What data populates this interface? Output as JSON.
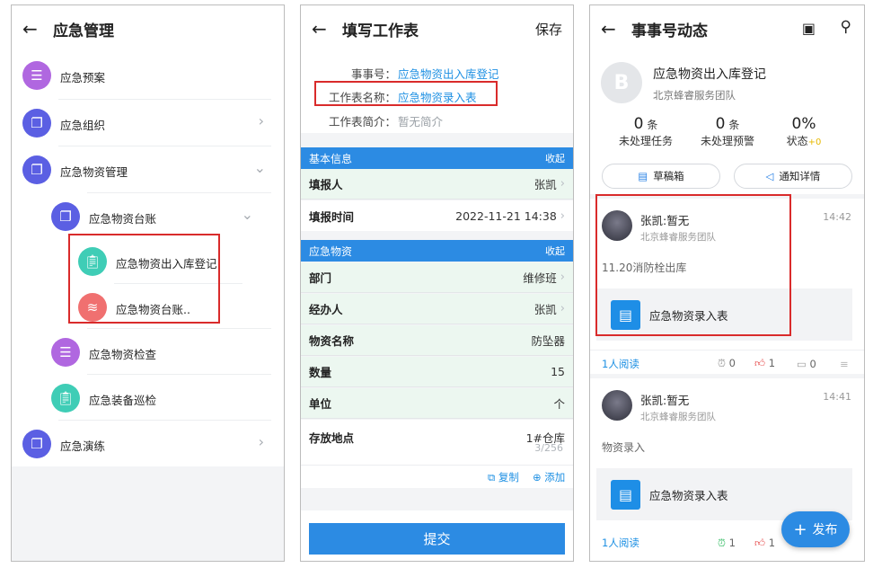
{
  "p1": {
    "title": "应急管理",
    "items": [
      {
        "label": "应急预案",
        "color": "#b067e0",
        "icon": "list-icon"
      },
      {
        "label": "应急组织",
        "color": "#5b5fe3",
        "icon": "layers-icon"
      },
      {
        "label": "应急物资管理",
        "color": "#5b5fe3",
        "icon": "layers-icon"
      },
      {
        "label": "应急物资台账",
        "color": "#5b5fe3",
        "icon": "layers-icon"
      },
      {
        "label": "应急物资出入库登记",
        "color": "#3fcdb6",
        "icon": "clipboard-icon"
      },
      {
        "label": "应急物资台账..",
        "color": "#f07070",
        "icon": "database-icon"
      },
      {
        "label": "应急物资检查",
        "color": "#b067e0",
        "icon": "list-icon"
      },
      {
        "label": "应急装备巡检",
        "color": "#3fcdb6",
        "icon": "clipboard-icon"
      },
      {
        "label": "应急演练",
        "color": "#5b5fe3",
        "icon": "layers-icon"
      }
    ]
  },
  "p2": {
    "title": "填写工作表",
    "save": "保存",
    "info": [
      {
        "k": "事事号：",
        "v": "应急物资出入库登记"
      },
      {
        "k": "工作表名称：",
        "v": "应急物资录入表"
      },
      {
        "k": "工作表简介：",
        "v": "暂无简介"
      }
    ],
    "sec1": {
      "title": "基本信息",
      "fold": "收起"
    },
    "rows1": [
      {
        "k": "填报人",
        "v": "张凯"
      },
      {
        "k": "填报时间",
        "v": "2022-11-21 14:38"
      }
    ],
    "sec2": {
      "title": "应急物资",
      "fold": "收起"
    },
    "rows2": [
      {
        "k": "部门",
        "v": "维修班"
      },
      {
        "k": "经办人",
        "v": "张凯"
      },
      {
        "k": "物资名称",
        "v": "防坠器"
      },
      {
        "k": "数量",
        "v": "15"
      },
      {
        "k": "单位",
        "v": "个"
      },
      {
        "k": "存放地点",
        "v": "1#仓库"
      }
    ],
    "counter": "3/256",
    "copy": "复制",
    "add": "添加",
    "submit": "提交"
  },
  "p3": {
    "title": "事事号动态",
    "name": "应急物资出入库登记",
    "team": "北京蜂睿服务团队",
    "stats": [
      {
        "n": "0",
        "u": "条",
        "l": "未处理任务"
      },
      {
        "n": "0",
        "u": "条",
        "l": "未处理预警"
      },
      {
        "n": "0%",
        "u": "",
        "l": "状态",
        "extra": "+0"
      }
    ],
    "draft": "草稿箱",
    "notice": "通知详情",
    "posts": [
      {
        "user": "张凯:暂无",
        "team": "北京蜂睿服务团队",
        "time": "14:42",
        "text": "11.20消防栓出库",
        "attach": "应急物资录入表",
        "read": "1人阅读",
        "c1": "0",
        "c2": "1",
        "c3": "0"
      },
      {
        "user": "张凯:暂无",
        "team": "北京蜂睿服务团队",
        "time": "14:41",
        "text": "物资录入",
        "attach": "应急物资录入表",
        "read": "1人阅读",
        "c1": "1",
        "c2": "1"
      }
    ],
    "publish": "发布"
  },
  "colors": {
    "accent": "#2c8be3",
    "link": "#1e90e3",
    "highlight": "#d92b2b",
    "green_row": "#ecf7f0"
  }
}
